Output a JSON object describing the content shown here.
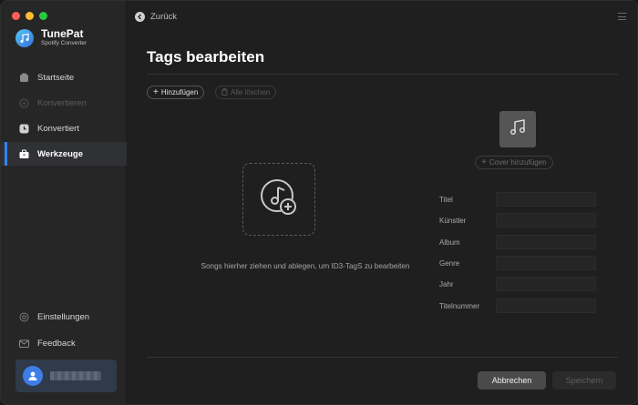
{
  "window": {
    "controls": [
      "close",
      "minimize",
      "zoom"
    ]
  },
  "brand": {
    "name": "TunePat",
    "subtitle": "Spotify Converter",
    "logo_icon": "music-note-icon"
  },
  "sidebar": {
    "items": [
      {
        "label": "Startseite",
        "icon": "home-icon",
        "state": "normal"
      },
      {
        "label": "Konvertieren",
        "icon": "convert-icon",
        "state": "disabled"
      },
      {
        "label": "Konvertiert",
        "icon": "clock-icon",
        "state": "normal"
      },
      {
        "label": "Werkzeuge",
        "icon": "toolbox-icon",
        "state": "active"
      }
    ],
    "bottom_items": [
      {
        "label": "Einstellungen",
        "icon": "gear-icon"
      },
      {
        "label": "Feedback",
        "icon": "mail-icon"
      }
    ],
    "account": {
      "avatar_icon": "user-icon"
    }
  },
  "header": {
    "back_label": "Zurück",
    "menu_icon": "hamburger-icon"
  },
  "main": {
    "title": "Tags bearbeiten",
    "add_label": "Hinzufügen",
    "clear_label": "Alle löschen",
    "drop_hint": "Songs hierher ziehen und ablegen, um ID3-TagS zu bearbeiten",
    "cover_button": "Cover hinzufügen",
    "fields": [
      {
        "label": "Titel",
        "value": ""
      },
      {
        "label": "Künstler",
        "value": ""
      },
      {
        "label": "Album",
        "value": ""
      },
      {
        "label": "Genre",
        "value": ""
      },
      {
        "label": "Jahr",
        "value": ""
      },
      {
        "label": "Titelnummer",
        "value": ""
      }
    ],
    "cancel_label": "Abbrechen",
    "save_label": "Speichern"
  },
  "colors": {
    "accent": "#2f86f6",
    "background": "#1f1f1f",
    "sidebar": "#262626"
  }
}
